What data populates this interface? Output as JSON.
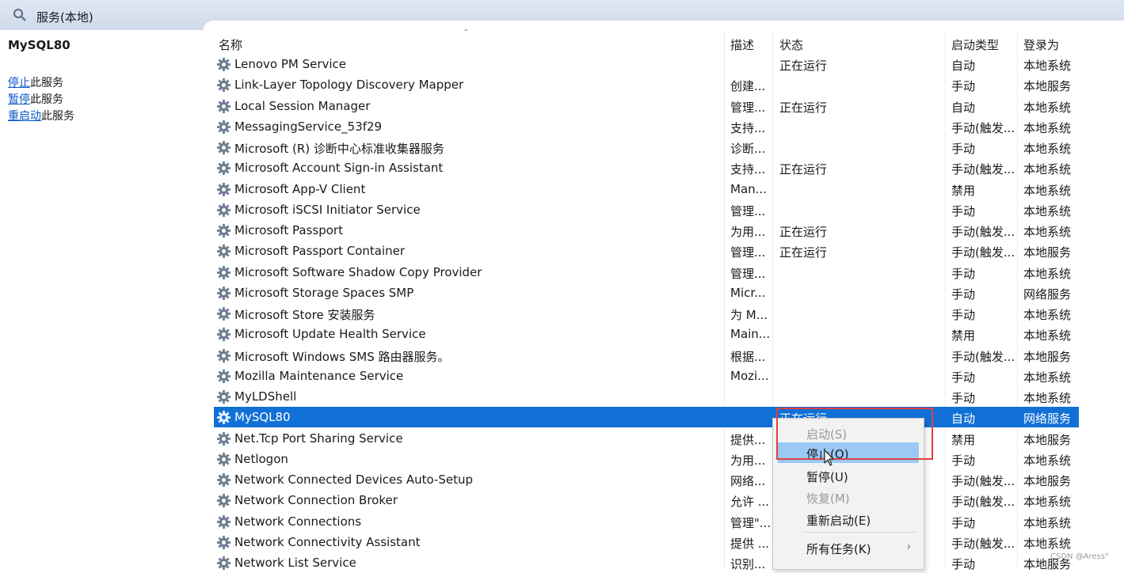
{
  "window": {
    "title": "服务(本地)",
    "search_icon": "search-icon"
  },
  "left_pane": {
    "service_name": "MySQL80",
    "actions": [
      {
        "link": "停止",
        "rest": "此服务"
      },
      {
        "link": "暂停",
        "rest": "此服务"
      },
      {
        "link": "重启动",
        "rest": "此服务"
      }
    ]
  },
  "columns": {
    "name": "名称",
    "desc": "描述",
    "status": "状态",
    "startup": "启动类型",
    "logon": "登录为"
  },
  "rows": [
    {
      "name": "Lenovo PM Service",
      "desc": "",
      "status": "正在运行",
      "startup": "自动",
      "logon": "本地系统"
    },
    {
      "name": "Link-Layer Topology Discovery Mapper",
      "desc": "创建...",
      "status": "",
      "startup": "手动",
      "logon": "本地服务"
    },
    {
      "name": "Local Session Manager",
      "desc": "管理...",
      "status": "正在运行",
      "startup": "自动",
      "logon": "本地系统"
    },
    {
      "name": "MessagingService_53f29",
      "desc": "支持...",
      "status": "",
      "startup": "手动(触发...",
      "logon": "本地系统"
    },
    {
      "name": "Microsoft (R) 诊断中心标准收集器服务",
      "desc": "诊断...",
      "status": "",
      "startup": "手动",
      "logon": "本地系统"
    },
    {
      "name": "Microsoft Account Sign-in Assistant",
      "desc": "支持...",
      "status": "正在运行",
      "startup": "手动(触发...",
      "logon": "本地系统"
    },
    {
      "name": "Microsoft App-V Client",
      "desc": "Man...",
      "status": "",
      "startup": "禁用",
      "logon": "本地系统"
    },
    {
      "name": "Microsoft iSCSI Initiator Service",
      "desc": "管理...",
      "status": "",
      "startup": "手动",
      "logon": "本地系统"
    },
    {
      "name": "Microsoft Passport",
      "desc": "为用...",
      "status": "正在运行",
      "startup": "手动(触发...",
      "logon": "本地系统"
    },
    {
      "name": "Microsoft Passport Container",
      "desc": "管理...",
      "status": "正在运行",
      "startup": "手动(触发...",
      "logon": "本地服务"
    },
    {
      "name": "Microsoft Software Shadow Copy Provider",
      "desc": "管理...",
      "status": "",
      "startup": "手动",
      "logon": "本地系统"
    },
    {
      "name": "Microsoft Storage Spaces SMP",
      "desc": "Micr...",
      "status": "",
      "startup": "手动",
      "logon": "网络服务"
    },
    {
      "name": "Microsoft Store 安装服务",
      "desc": "为 M...",
      "status": "",
      "startup": "手动",
      "logon": "本地系统"
    },
    {
      "name": "Microsoft Update Health Service",
      "desc": "Main...",
      "status": "",
      "startup": "禁用",
      "logon": "本地系统"
    },
    {
      "name": "Microsoft Windows SMS 路由器服务。",
      "desc": "根据...",
      "status": "",
      "startup": "手动(触发...",
      "logon": "本地服务"
    },
    {
      "name": "Mozilla Maintenance Service",
      "desc": "Mozi...",
      "status": "",
      "startup": "手动",
      "logon": "本地系统"
    },
    {
      "name": "MyLDShell",
      "desc": "",
      "status": "",
      "startup": "手动",
      "logon": "本地系统"
    },
    {
      "name": "MySQL80",
      "desc": "",
      "status": "正在运行",
      "startup": "自动",
      "logon": "网络服务",
      "selected": true
    },
    {
      "name": "Net.Tcp Port Sharing Service",
      "desc": "提供...",
      "status": "",
      "startup": "禁用",
      "logon": "本地服务"
    },
    {
      "name": "Netlogon",
      "desc": "为用...",
      "status": "",
      "startup": "手动",
      "logon": "本地系统"
    },
    {
      "name": "Network Connected Devices Auto-Setup",
      "desc": "网络...",
      "status": "",
      "startup": "手动(触发...",
      "logon": "本地服务"
    },
    {
      "name": "Network Connection Broker",
      "desc": "允许 ...",
      "status": "",
      "startup": "手动(触发...",
      "logon": "本地系统"
    },
    {
      "name": "Network Connections",
      "desc": "管理\"...",
      "status": "",
      "startup": "手动",
      "logon": "本地系统"
    },
    {
      "name": "Network Connectivity Assistant",
      "desc": "提供 ...",
      "status": "",
      "startup": "手动(触发...",
      "logon": "本地系统"
    },
    {
      "name": "Network List Service",
      "desc": "识别...",
      "status": "",
      "startup": "手动",
      "logon": "本地服务"
    }
  ],
  "context_menu": {
    "items": [
      {
        "label": "启动(S)",
        "disabled": true
      },
      {
        "label": "停止(O)",
        "highlighted": true
      },
      {
        "label": "暂停(U)"
      },
      {
        "label": "恢复(M)",
        "disabled": true
      },
      {
        "label": "重新启动(E)"
      },
      {
        "label": "所有任务(K)",
        "submenu": true
      }
    ]
  },
  "watermark": "CSDN @Aress\"",
  "colors": {
    "selection": "#1170d6",
    "menu_highlight": "#99c9f4",
    "link": "#0b57c9",
    "annotation": "#e04040"
  }
}
